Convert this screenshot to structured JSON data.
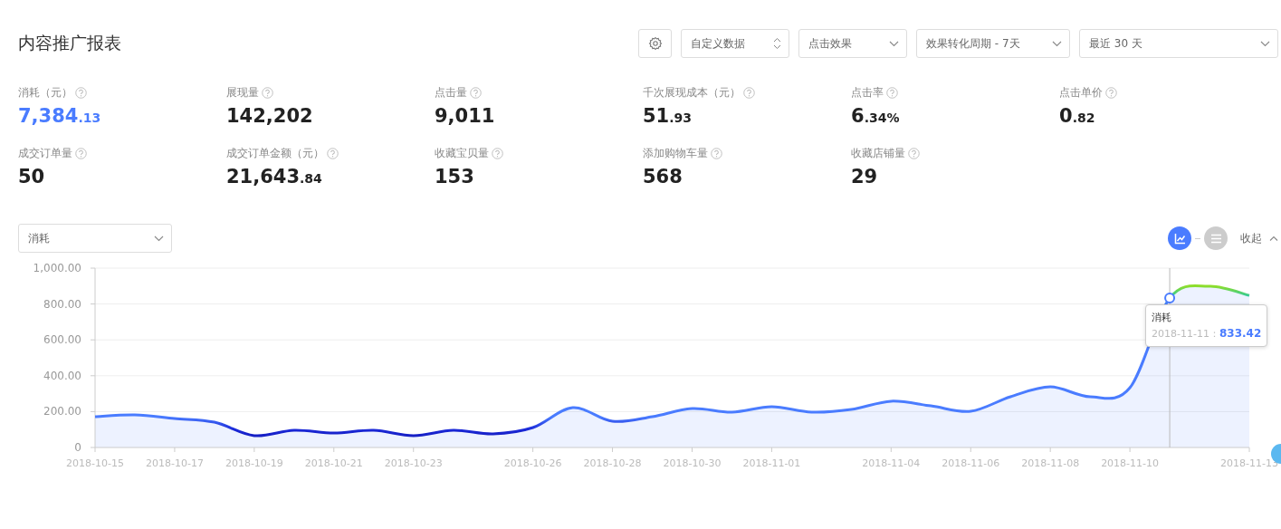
{
  "title": "内容推广报表",
  "toolbar": {
    "filters": [
      {
        "kind": "spinner",
        "value": "自定义数据"
      },
      {
        "kind": "dropdown",
        "value": "点击效果"
      },
      {
        "kind": "dropdown",
        "value": "效果转化周期 - 7天"
      },
      {
        "kind": "dropdown",
        "value": "最近 30 天"
      }
    ]
  },
  "metrics": [
    {
      "label": "消耗（元）",
      "value": "7,384",
      "decimal": ".13",
      "selected": true
    },
    {
      "label": "展现量",
      "value": "142,202",
      "selected": false
    },
    {
      "label": "点击量",
      "value": "9,011",
      "selected": false
    },
    {
      "label": "千次展现成本（元）",
      "value": "51",
      "decimal": ".93",
      "selected": false
    },
    {
      "label": "点击率",
      "value": "6",
      "decimal": ".34%",
      "selected": false
    },
    {
      "label": "点击单价",
      "value": "0",
      "decimal": ".82",
      "selected": false
    },
    {
      "label": "成交订单量",
      "value": "50",
      "selected": false
    },
    {
      "label": "成交订单金额（元）",
      "value": "21,643",
      "decimal": ".84",
      "selected": false
    },
    {
      "label": "收藏宝贝量",
      "value": "153",
      "selected": false
    },
    {
      "label": "添加购物车量",
      "value": "568",
      "selected": false
    },
    {
      "label": "收藏店铺量",
      "value": "29",
      "selected": false
    }
  ],
  "chart_section": {
    "metric_select": {
      "value": "消耗"
    },
    "view_toggle": [
      {
        "kind": "chart",
        "selected": true
      },
      {
        "kind": "table",
        "selected": false
      }
    ],
    "collapse_link": "收起",
    "tooltip": {
      "date": "2018-11-11：",
      "value": "833.42"
    },
    "chart_data": {
      "type": "area",
      "categories": [
        "2018-10-15",
        null,
        "2018-10-17",
        null,
        "2018-10-19",
        null,
        "2018-10-21",
        null,
        "2018-10-23",
        null,
        null,
        "2018-10-26",
        null,
        "2018-10-28",
        null,
        "2018-10-30",
        null,
        "2018-11-01",
        null,
        null,
        "2018-11-04",
        null,
        "2018-11-06",
        null,
        "2018-11-08",
        null,
        "2018-11-10",
        null,
        null,
        "2018-11-13"
      ],
      "series": [
        {
          "name": "消耗",
          "color": "#4a7cff",
          "values": [
            172,
            182,
            162,
            141,
            66,
            96,
            81,
            96,
            66,
            96,
            76,
            111,
            222,
            146,
            172,
            217,
            197,
            227,
            197,
            212,
            258,
            232,
            202,
            283,
            338,
            283,
            333,
            833,
            899,
            848
          ]
        }
      ],
      "grid": true,
      "ylim": [
        0,
        1000
      ],
      "yticks": [
        {
          "value": 0,
          "label": "0"
        },
        {
          "value": 200,
          "label": "200.00"
        },
        {
          "value": 400,
          "label": "400.00"
        },
        {
          "value": 600,
          "label": "600.00"
        },
        {
          "value": 800,
          "label": "800.00"
        },
        {
          "value": 1000,
          "label": "1,000.00"
        }
      ]
    }
  }
}
